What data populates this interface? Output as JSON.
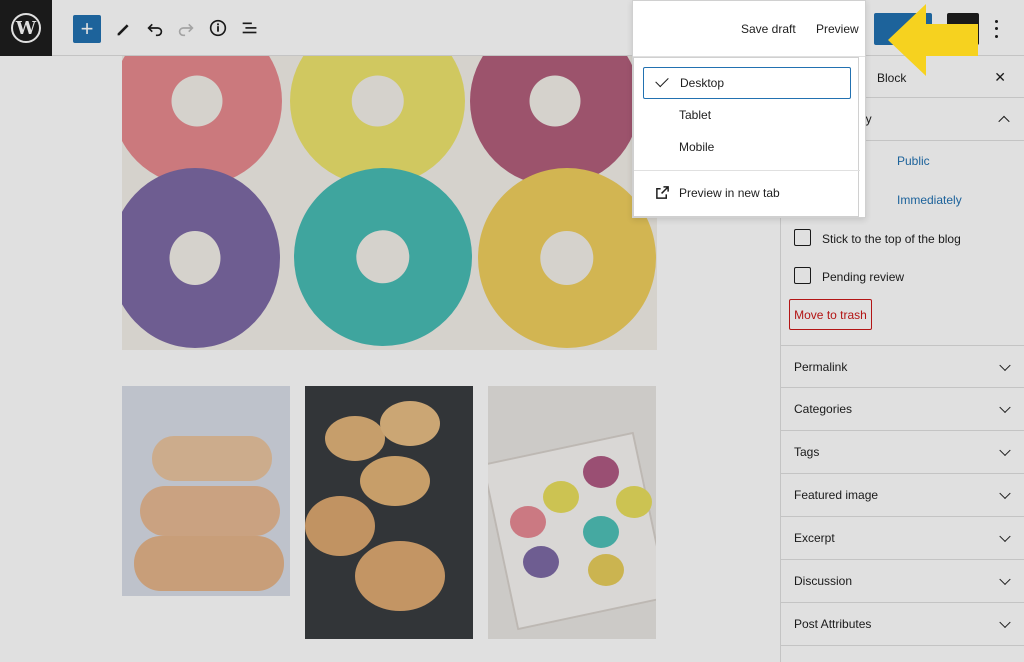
{
  "toolbar": {
    "add_icon": "plus-icon",
    "tools_icon": "pencil-icon",
    "undo_icon": "undo-icon",
    "redo_icon": "redo-icon",
    "details_icon": "info-icon",
    "list_view_icon": "list-view-icon",
    "save_draft": "Save draft",
    "preview": "Preview",
    "more_icon": "more-vertical-icon"
  },
  "preview_menu": {
    "items": [
      {
        "label": "Desktop",
        "selected": true
      },
      {
        "label": "Tablet",
        "selected": false
      },
      {
        "label": "Mobile",
        "selected": false
      }
    ],
    "new_tab": "Preview in new tab"
  },
  "sidebar": {
    "tab_block": "Block",
    "status_heading_fragment": "ibility",
    "visibility_value": "Public",
    "publish_value": "Immediately",
    "stick_top": "Stick to the top of the blog",
    "pending_review": "Pending review",
    "move_to_trash": "Move to trash",
    "panels": [
      "Permalink",
      "Categories",
      "Tags",
      "Featured image",
      "Excerpt",
      "Discussion",
      "Post Attributes"
    ]
  },
  "colors": {
    "accent": "#2271b1",
    "annotation_arrow": "#f6d21f",
    "danger": "#cc1818"
  }
}
